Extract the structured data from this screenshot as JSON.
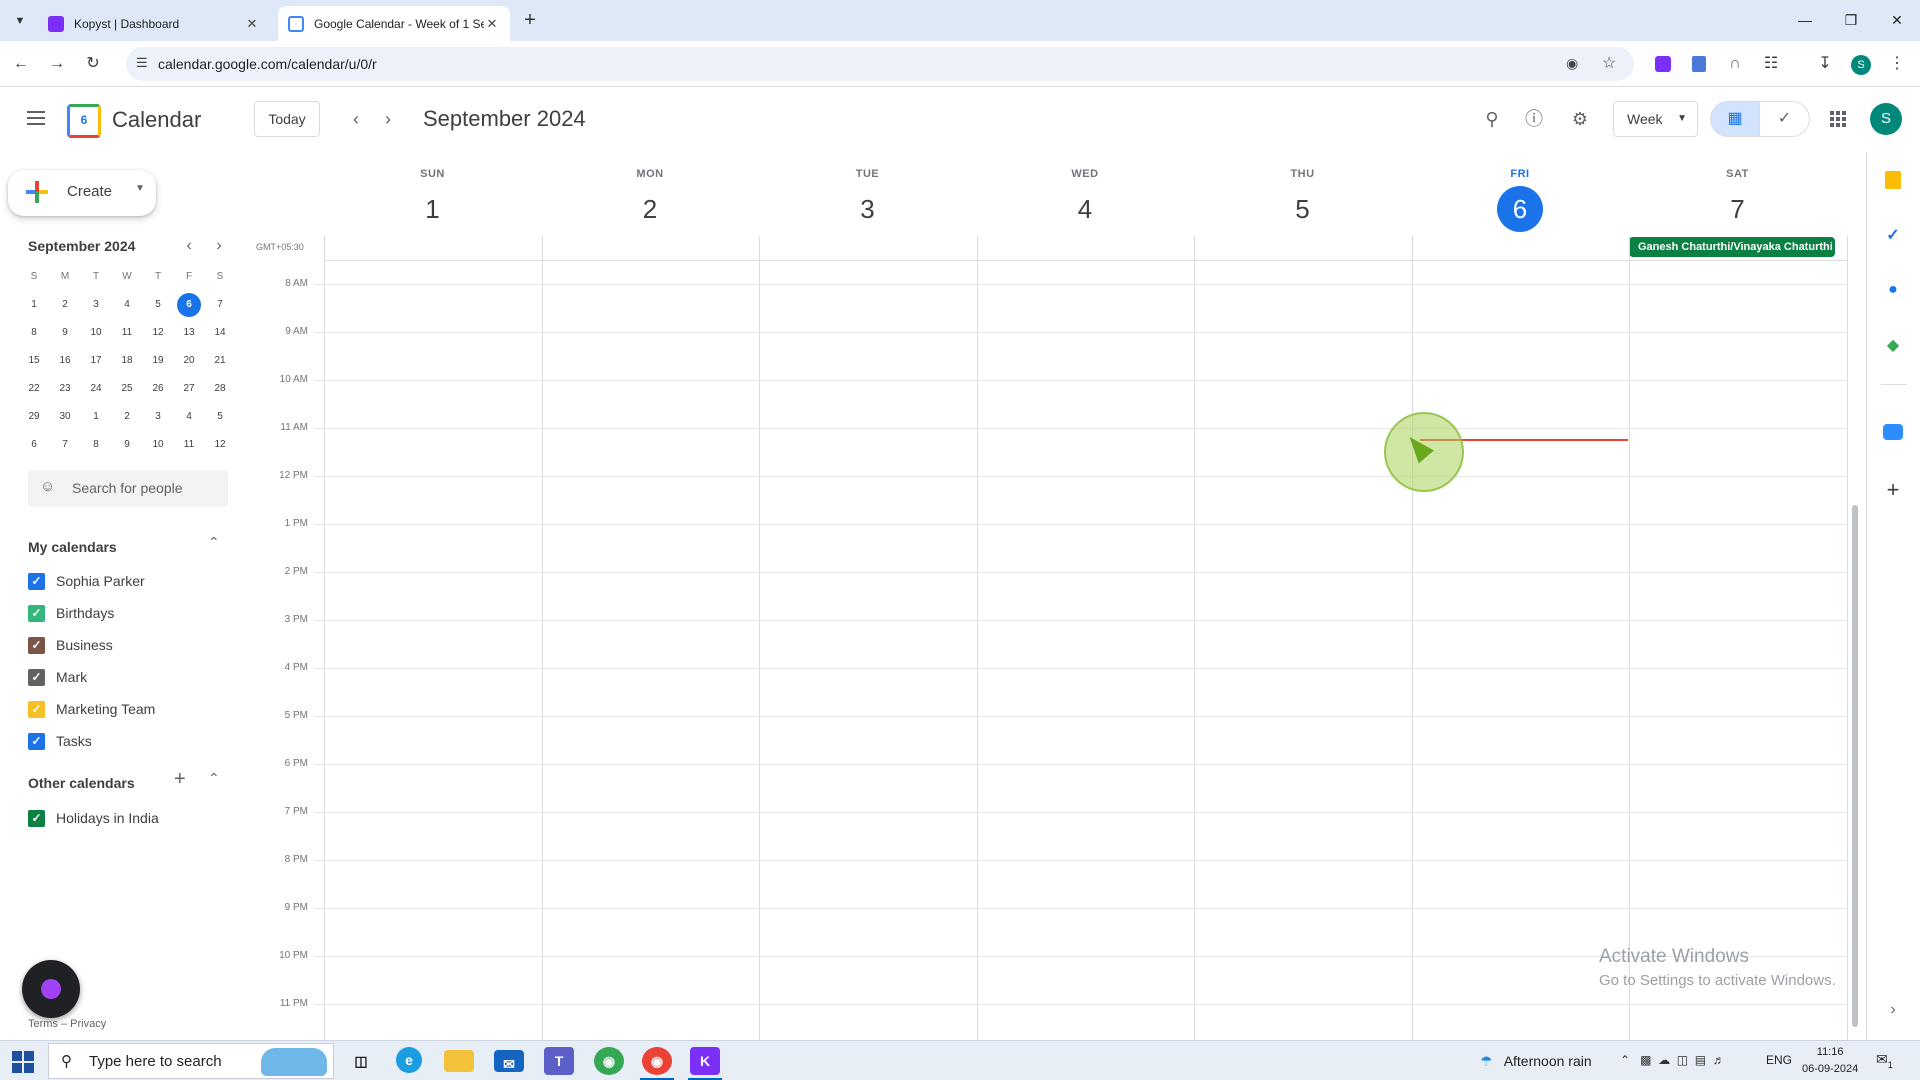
{
  "browser": {
    "tabs": [
      {
        "title": "Kopyst | Dashboard",
        "active": false
      },
      {
        "title": "Google Calendar - Week of 1 Se",
        "active": true
      }
    ],
    "new_tab": "+",
    "url": "calendar.google.com/calendar/u/0/r",
    "profile_initial": "S"
  },
  "header": {
    "app_name": "Calendar",
    "logo_day": "6",
    "today_label": "Today",
    "title": "September 2024",
    "view_select": "Week",
    "avatar_initial": "S"
  },
  "sidebar": {
    "create_label": "Create",
    "mini_calendar": {
      "title": "September 2024",
      "weekdays": [
        "S",
        "M",
        "T",
        "W",
        "T",
        "F",
        "S"
      ],
      "weeks": [
        [
          "1",
          "2",
          "3",
          "4",
          "5",
          "6",
          "7"
        ],
        [
          "8",
          "9",
          "10",
          "11",
          "12",
          "13",
          "14"
        ],
        [
          "15",
          "16",
          "17",
          "18",
          "19",
          "20",
          "21"
        ],
        [
          "22",
          "23",
          "24",
          "25",
          "26",
          "27",
          "28"
        ],
        [
          "29",
          "30",
          "1",
          "2",
          "3",
          "4",
          "5"
        ],
        [
          "6",
          "7",
          "8",
          "9",
          "10",
          "11",
          "12"
        ]
      ],
      "selected": "6"
    },
    "search_people_placeholder": "Search for people",
    "my_calendars": {
      "title": "My calendars",
      "items": [
        {
          "label": "Sophia Parker",
          "color": "#1a73e8"
        },
        {
          "label": "Birthdays",
          "color": "#33b679"
        },
        {
          "label": "Business",
          "color": "#795548"
        },
        {
          "label": "Mark",
          "color": "#616161"
        },
        {
          "label": "Marketing Team",
          "color": "#f6bf26"
        },
        {
          "label": "Tasks",
          "color": "#1a73e8"
        }
      ]
    },
    "other_calendars": {
      "title": "Other calendars",
      "items": [
        {
          "label": "Holidays in India",
          "color": "#0b8043"
        }
      ]
    },
    "footer": "Terms – Privacy"
  },
  "week": {
    "timezone": "GMT+05:30",
    "days": [
      {
        "dow": "SUN",
        "date": "1",
        "today": false
      },
      {
        "dow": "MON",
        "date": "2",
        "today": false
      },
      {
        "dow": "TUE",
        "date": "3",
        "today": false
      },
      {
        "dow": "WED",
        "date": "4",
        "today": false
      },
      {
        "dow": "THU",
        "date": "5",
        "today": false
      },
      {
        "dow": "FRI",
        "date": "6",
        "today": true
      },
      {
        "dow": "SAT",
        "date": "7",
        "today": false
      }
    ],
    "hours": [
      "8 AM",
      "9 AM",
      "10 AM",
      "11 AM",
      "12 PM",
      "1 PM",
      "2 PM",
      "3 PM",
      "4 PM",
      "5 PM",
      "6 PM",
      "7 PM",
      "8 PM",
      "9 PM",
      "10 PM",
      "11 PM"
    ],
    "all_day_event": "Ganesh Chaturthi/Vinayaka Chaturthi",
    "accent": "#1a73e8",
    "holiday_color": "#0b8043",
    "now_line_color": "#ea4335"
  },
  "watermark": {
    "line1": "Activate Windows",
    "line2": "Go to Settings to activate Windows."
  },
  "taskbar": {
    "search_placeholder": "Type here to search",
    "weather": "Afternoon rain",
    "language": "ENG",
    "time": "11:16",
    "date": "06-09-2024",
    "notification_count": "1"
  }
}
